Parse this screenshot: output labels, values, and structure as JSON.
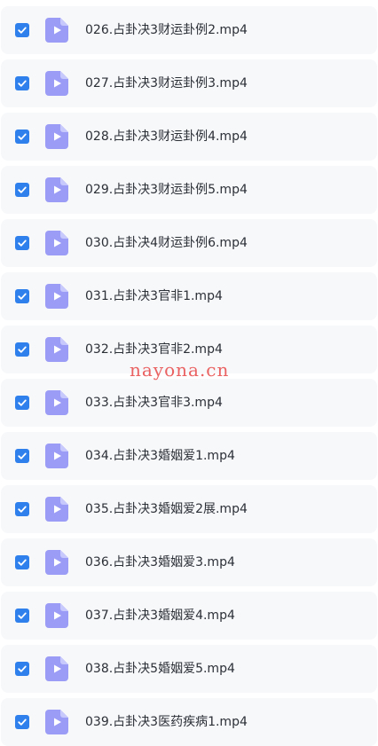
{
  "accent_color": "#2f80ed",
  "file_icon_color": "#9b9cf6",
  "files": [
    {
      "name": "026.占卦决3财运卦例2.mp4",
      "checked": true,
      "icon": "video-file-icon"
    },
    {
      "name": "027.占卦决3财运卦例3.mp4",
      "checked": true,
      "icon": "video-file-icon"
    },
    {
      "name": "028.占卦决3财运卦例4.mp4",
      "checked": true,
      "icon": "video-file-icon"
    },
    {
      "name": "029.占卦决3财运卦例5.mp4",
      "checked": true,
      "icon": "video-file-icon"
    },
    {
      "name": "030.占卦决4财运卦例6.mp4",
      "checked": true,
      "icon": "video-file-icon"
    },
    {
      "name": "031.占卦决3官非1.mp4",
      "checked": true,
      "icon": "video-file-icon"
    },
    {
      "name": "032.占卦决3官非2.mp4",
      "checked": true,
      "icon": "video-file-icon"
    },
    {
      "name": "033.占卦决3官非3.mp4",
      "checked": true,
      "icon": "video-file-icon"
    },
    {
      "name": "034.占卦决3婚姻爱1.mp4",
      "checked": true,
      "icon": "video-file-icon"
    },
    {
      "name": "035.占卦决3婚姻爱2展.mp4",
      "checked": true,
      "icon": "video-file-icon"
    },
    {
      "name": "036.占卦决3婚姻爱3.mp4",
      "checked": true,
      "icon": "video-file-icon"
    },
    {
      "name": "037.占卦决3婚姻爱4.mp4",
      "checked": true,
      "icon": "video-file-icon"
    },
    {
      "name": "038.占卦决5婚姻爱5.mp4",
      "checked": true,
      "icon": "video-file-icon"
    },
    {
      "name": "039.占卦决3医药疾病1.mp4",
      "checked": true,
      "icon": "video-file-icon"
    }
  ],
  "watermark": "nayona.cn"
}
